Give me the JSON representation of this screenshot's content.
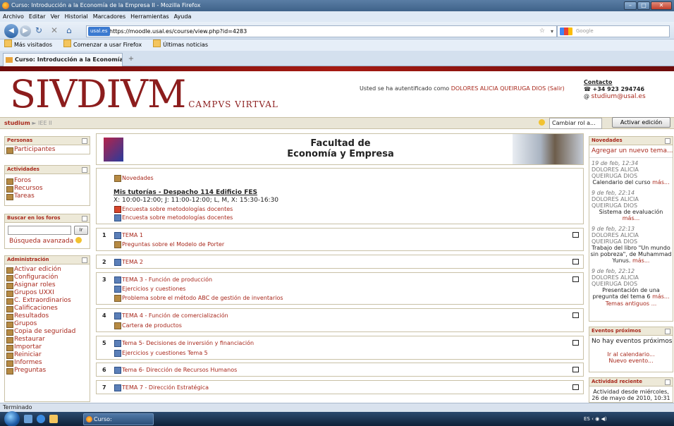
{
  "window": {
    "title": "Curso: Introducción a la Economía de la Empresa II - Mozilla Firefox"
  },
  "menu": [
    "Archivo",
    "Editar",
    "Ver",
    "Historial",
    "Marcadores",
    "Herramientas",
    "Ayuda"
  ],
  "nav": {
    "site_badge": "usal.es",
    "url": "https://moodle.usal.es/course/view.php?id=4283",
    "search_placeholder": "Google"
  },
  "bookmarks": [
    "Más visitados",
    "Comenzar a usar Firefox",
    "Últimas noticias"
  ],
  "tab": {
    "label": "Curso: Introducción a la Economía de ..."
  },
  "header": {
    "logo_main": "SIVDIVM",
    "logo_sub": "CAMPVS VIRTVAL",
    "auth_prefix": "Usted se ha autentificado como",
    "auth_user": "DOLORES ALICIA QUEIRUGA DIOS",
    "auth_logout": "(Salir)",
    "contact_title": "Contacto",
    "contact_phone": "+34 923 294746",
    "contact_email": "studium@usal.es"
  },
  "breadcrumb": {
    "home": "studium",
    "sep": "►",
    "course": "IEE II"
  },
  "toolbar": {
    "role_label": "Cambiar rol a...",
    "edit_button": "Activar edición"
  },
  "left": {
    "personas": {
      "title": "Personas",
      "items": [
        "Participantes"
      ]
    },
    "actividades": {
      "title": "Actividades",
      "items": [
        "Foros",
        "Recursos",
        "Tareas"
      ]
    },
    "buscar": {
      "title": "Buscar en los foros",
      "go": "Ir",
      "advanced": "Búsqueda avanzada"
    },
    "admin": {
      "title": "Administración",
      "items": [
        "Activar edición",
        "Configuración",
        "Asignar roles",
        "Grupos UXXI",
        "C. Extraordinarios",
        "Calificaciones",
        "Resultados",
        "Grupos",
        "Copia de seguridad",
        "Restaurar",
        "Importar",
        "Reiniciar",
        "Informes",
        "Preguntas"
      ]
    }
  },
  "center": {
    "faculty_line1": "Facultad de",
    "faculty_line2": "Economía y Empresa",
    "top": {
      "novedades": "Novedades",
      "tutorias_title": "Mis tutorías - Despacho 114 Edificio FES",
      "tutorias_hours": "X: 10:00-12:00; J: 11:00-12:00; L, M, X: 15:30-16:30",
      "encuesta1": "Encuesta sobre metodologías docentes",
      "encuesta2": "Encuesta sobre metodologías docentes"
    },
    "sections": [
      {
        "num": "1",
        "items": [
          "TEMA 1",
          "Preguntas sobre el Modelo de Porter"
        ]
      },
      {
        "num": "2",
        "items": [
          "TEMA 2"
        ]
      },
      {
        "num": "3",
        "items": [
          "TEMA 3 - Función de producción",
          "Ejercicios y cuestiones",
          "Problema sobre el método ABC de gestión de inventarios"
        ]
      },
      {
        "num": "4",
        "items": [
          "TEMA 4 - Función de comercialización",
          "Cartera de productos"
        ]
      },
      {
        "num": "5",
        "items": [
          "Tema 5- Decisiones de inversión y financiación",
          "Ejercicios y cuestiones Tema 5"
        ]
      },
      {
        "num": "6",
        "items": [
          "Tema 6- Dirección de Recursos Humanos"
        ]
      },
      {
        "num": "7",
        "items": [
          "TEMA 7 - Dirección Estratégica"
        ]
      }
    ]
  },
  "right": {
    "novedades": {
      "title": "Novedades",
      "add": "Agregar un nuevo tema...",
      "posts": [
        {
          "date": "19 de feb, 12:34",
          "author1": "DOLORES ALICIA",
          "author2": "QUEIRUGA DIOS",
          "text": "Calendario del curso",
          "more": "más..."
        },
        {
          "date": "9 de feb, 22:14",
          "author1": "DOLORES ALICIA",
          "author2": "QUEIRUGA DIOS",
          "text": "Sistema de evaluación",
          "more": "más..."
        },
        {
          "date": "9 de feb, 22:13",
          "author1": "DOLORES ALICIA",
          "author2": "QUEIRUGA DIOS",
          "text": "Trabajo del libro \"Un mundo sin pobreza\", de Muhammad Yunus.",
          "more": "más..."
        },
        {
          "date": "9 de feb, 22:12",
          "author1": "DOLORES ALICIA",
          "author2": "QUEIRUGA DIOS",
          "text": "Presentación de una pregunta del tema 6",
          "more": "más..."
        }
      ],
      "older": "Temas antiguos ..."
    },
    "eventos": {
      "title": "Eventos próximos",
      "none": "No hay eventos próximos",
      "calendar": "Ir al calendario...",
      "new": "Nuevo evento..."
    },
    "reciente": {
      "title": "Actividad reciente",
      "text": "Actividad desde miércoles, 26 de mayo de 2010, 10:31"
    }
  },
  "status": "Terminado",
  "taskbar": {
    "task": "Curso: Introducción...",
    "tray": "ES"
  }
}
